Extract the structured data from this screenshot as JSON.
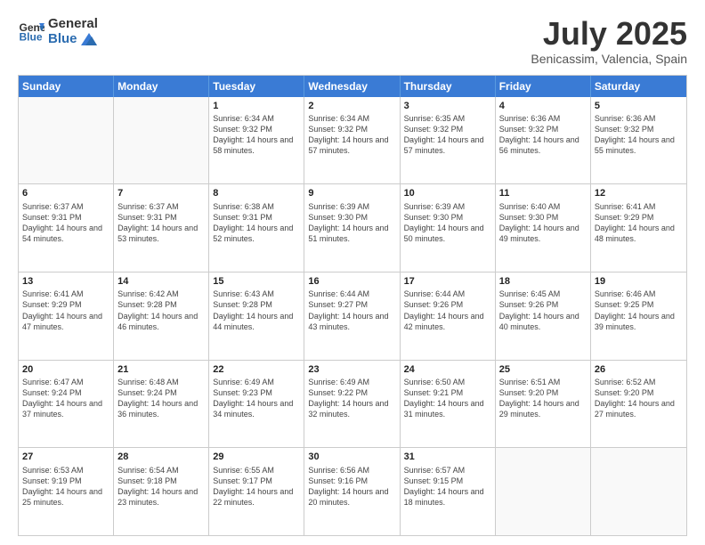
{
  "header": {
    "logo_line1": "General",
    "logo_line2": "Blue",
    "month": "July 2025",
    "location": "Benicassim, Valencia, Spain"
  },
  "weekdays": [
    "Sunday",
    "Monday",
    "Tuesday",
    "Wednesday",
    "Thursday",
    "Friday",
    "Saturday"
  ],
  "weeks": [
    [
      {
        "day": "",
        "sunrise": "",
        "sunset": "",
        "daylight": ""
      },
      {
        "day": "",
        "sunrise": "",
        "sunset": "",
        "daylight": ""
      },
      {
        "day": "1",
        "sunrise": "Sunrise: 6:34 AM",
        "sunset": "Sunset: 9:32 PM",
        "daylight": "Daylight: 14 hours and 58 minutes."
      },
      {
        "day": "2",
        "sunrise": "Sunrise: 6:34 AM",
        "sunset": "Sunset: 9:32 PM",
        "daylight": "Daylight: 14 hours and 57 minutes."
      },
      {
        "day": "3",
        "sunrise": "Sunrise: 6:35 AM",
        "sunset": "Sunset: 9:32 PM",
        "daylight": "Daylight: 14 hours and 57 minutes."
      },
      {
        "day": "4",
        "sunrise": "Sunrise: 6:36 AM",
        "sunset": "Sunset: 9:32 PM",
        "daylight": "Daylight: 14 hours and 56 minutes."
      },
      {
        "day": "5",
        "sunrise": "Sunrise: 6:36 AM",
        "sunset": "Sunset: 9:32 PM",
        "daylight": "Daylight: 14 hours and 55 minutes."
      }
    ],
    [
      {
        "day": "6",
        "sunrise": "Sunrise: 6:37 AM",
        "sunset": "Sunset: 9:31 PM",
        "daylight": "Daylight: 14 hours and 54 minutes."
      },
      {
        "day": "7",
        "sunrise": "Sunrise: 6:37 AM",
        "sunset": "Sunset: 9:31 PM",
        "daylight": "Daylight: 14 hours and 53 minutes."
      },
      {
        "day": "8",
        "sunrise": "Sunrise: 6:38 AM",
        "sunset": "Sunset: 9:31 PM",
        "daylight": "Daylight: 14 hours and 52 minutes."
      },
      {
        "day": "9",
        "sunrise": "Sunrise: 6:39 AM",
        "sunset": "Sunset: 9:30 PM",
        "daylight": "Daylight: 14 hours and 51 minutes."
      },
      {
        "day": "10",
        "sunrise": "Sunrise: 6:39 AM",
        "sunset": "Sunset: 9:30 PM",
        "daylight": "Daylight: 14 hours and 50 minutes."
      },
      {
        "day": "11",
        "sunrise": "Sunrise: 6:40 AM",
        "sunset": "Sunset: 9:30 PM",
        "daylight": "Daylight: 14 hours and 49 minutes."
      },
      {
        "day": "12",
        "sunrise": "Sunrise: 6:41 AM",
        "sunset": "Sunset: 9:29 PM",
        "daylight": "Daylight: 14 hours and 48 minutes."
      }
    ],
    [
      {
        "day": "13",
        "sunrise": "Sunrise: 6:41 AM",
        "sunset": "Sunset: 9:29 PM",
        "daylight": "Daylight: 14 hours and 47 minutes."
      },
      {
        "day": "14",
        "sunrise": "Sunrise: 6:42 AM",
        "sunset": "Sunset: 9:28 PM",
        "daylight": "Daylight: 14 hours and 46 minutes."
      },
      {
        "day": "15",
        "sunrise": "Sunrise: 6:43 AM",
        "sunset": "Sunset: 9:28 PM",
        "daylight": "Daylight: 14 hours and 44 minutes."
      },
      {
        "day": "16",
        "sunrise": "Sunrise: 6:44 AM",
        "sunset": "Sunset: 9:27 PM",
        "daylight": "Daylight: 14 hours and 43 minutes."
      },
      {
        "day": "17",
        "sunrise": "Sunrise: 6:44 AM",
        "sunset": "Sunset: 9:26 PM",
        "daylight": "Daylight: 14 hours and 42 minutes."
      },
      {
        "day": "18",
        "sunrise": "Sunrise: 6:45 AM",
        "sunset": "Sunset: 9:26 PM",
        "daylight": "Daylight: 14 hours and 40 minutes."
      },
      {
        "day": "19",
        "sunrise": "Sunrise: 6:46 AM",
        "sunset": "Sunset: 9:25 PM",
        "daylight": "Daylight: 14 hours and 39 minutes."
      }
    ],
    [
      {
        "day": "20",
        "sunrise": "Sunrise: 6:47 AM",
        "sunset": "Sunset: 9:24 PM",
        "daylight": "Daylight: 14 hours and 37 minutes."
      },
      {
        "day": "21",
        "sunrise": "Sunrise: 6:48 AM",
        "sunset": "Sunset: 9:24 PM",
        "daylight": "Daylight: 14 hours and 36 minutes."
      },
      {
        "day": "22",
        "sunrise": "Sunrise: 6:49 AM",
        "sunset": "Sunset: 9:23 PM",
        "daylight": "Daylight: 14 hours and 34 minutes."
      },
      {
        "day": "23",
        "sunrise": "Sunrise: 6:49 AM",
        "sunset": "Sunset: 9:22 PM",
        "daylight": "Daylight: 14 hours and 32 minutes."
      },
      {
        "day": "24",
        "sunrise": "Sunrise: 6:50 AM",
        "sunset": "Sunset: 9:21 PM",
        "daylight": "Daylight: 14 hours and 31 minutes."
      },
      {
        "day": "25",
        "sunrise": "Sunrise: 6:51 AM",
        "sunset": "Sunset: 9:20 PM",
        "daylight": "Daylight: 14 hours and 29 minutes."
      },
      {
        "day": "26",
        "sunrise": "Sunrise: 6:52 AM",
        "sunset": "Sunset: 9:20 PM",
        "daylight": "Daylight: 14 hours and 27 minutes."
      }
    ],
    [
      {
        "day": "27",
        "sunrise": "Sunrise: 6:53 AM",
        "sunset": "Sunset: 9:19 PM",
        "daylight": "Daylight: 14 hours and 25 minutes."
      },
      {
        "day": "28",
        "sunrise": "Sunrise: 6:54 AM",
        "sunset": "Sunset: 9:18 PM",
        "daylight": "Daylight: 14 hours and 23 minutes."
      },
      {
        "day": "29",
        "sunrise": "Sunrise: 6:55 AM",
        "sunset": "Sunset: 9:17 PM",
        "daylight": "Daylight: 14 hours and 22 minutes."
      },
      {
        "day": "30",
        "sunrise": "Sunrise: 6:56 AM",
        "sunset": "Sunset: 9:16 PM",
        "daylight": "Daylight: 14 hours and 20 minutes."
      },
      {
        "day": "31",
        "sunrise": "Sunrise: 6:57 AM",
        "sunset": "Sunset: 9:15 PM",
        "daylight": "Daylight: 14 hours and 18 minutes."
      },
      {
        "day": "",
        "sunrise": "",
        "sunset": "",
        "daylight": ""
      },
      {
        "day": "",
        "sunrise": "",
        "sunset": "",
        "daylight": ""
      }
    ]
  ]
}
